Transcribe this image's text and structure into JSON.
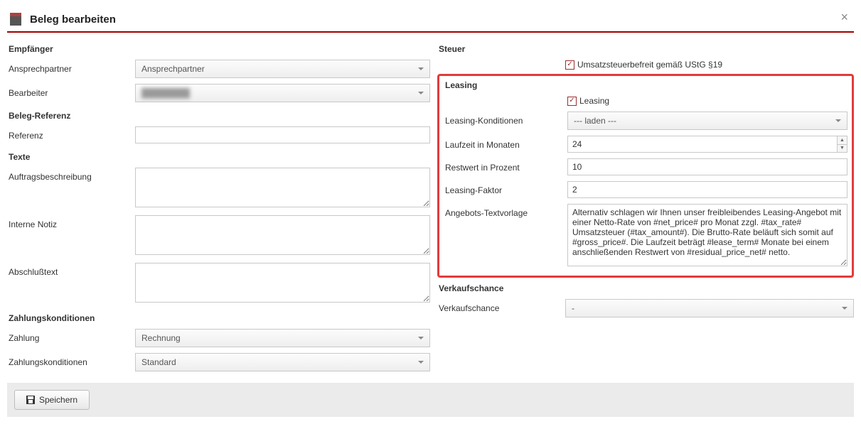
{
  "modal": {
    "title": "Beleg bearbeiten"
  },
  "left": {
    "empfaenger": {
      "title": "Empfänger",
      "ansprechpartner_label": "Ansprechpartner",
      "ansprechpartner_value": "Ansprechpartner",
      "bearbeiter_label": "Bearbeiter",
      "bearbeiter_value": "████████"
    },
    "belegref": {
      "title": "Beleg-Referenz",
      "referenz_label": "Referenz",
      "referenz_value": ""
    },
    "texte": {
      "title": "Texte",
      "auftrag_label": "Auftragsbeschreibung",
      "auftrag_value": "",
      "notiz_label": "Interne Notiz",
      "notiz_value": "",
      "abschluss_label": "Abschlußtext",
      "abschluss_value": ""
    },
    "zahlung": {
      "title": "Zahlungskonditionen",
      "zahlung_label": "Zahlung",
      "zahlung_value": "Rechnung",
      "konditionen_label": "Zahlungskonditionen",
      "konditionen_value": "Standard"
    }
  },
  "right": {
    "steuer": {
      "title": "Steuer",
      "befreit_label": "Umsatzsteuerbefreit gemäß UStG §19",
      "befreit_checked": true
    },
    "leasing": {
      "title": "Leasing",
      "leasing_check_label": "Leasing",
      "leasing_checked": true,
      "konditionen_label": "Leasing-Konditionen",
      "konditionen_value": "--- laden ---",
      "laufzeit_label": "Laufzeit in Monaten",
      "laufzeit_value": "24",
      "restwert_label": "Restwert in Prozent",
      "restwert_value": "10",
      "faktor_label": "Leasing-Faktor",
      "faktor_value": "2",
      "textvorlage_label": "Angebots-Textvorlage",
      "textvorlage_value": "Alternativ schlagen wir Ihnen unser freibleibendes Leasing-Angebot mit einer Netto-Rate von #net_price# pro Monat zzgl. #tax_rate# Umsatzsteuer (#tax_amount#). Die Brutto-Rate beläuft sich somit auf #gross_price#. Die Laufzeit beträgt #lease_term# Monate bei einem anschließenden Restwert von #residual_price_net# netto."
    },
    "verkauf": {
      "title": "Verkaufschance",
      "chance_label": "Verkaufschance",
      "chance_value": "-"
    }
  },
  "footer": {
    "save_label": "Speichern"
  }
}
